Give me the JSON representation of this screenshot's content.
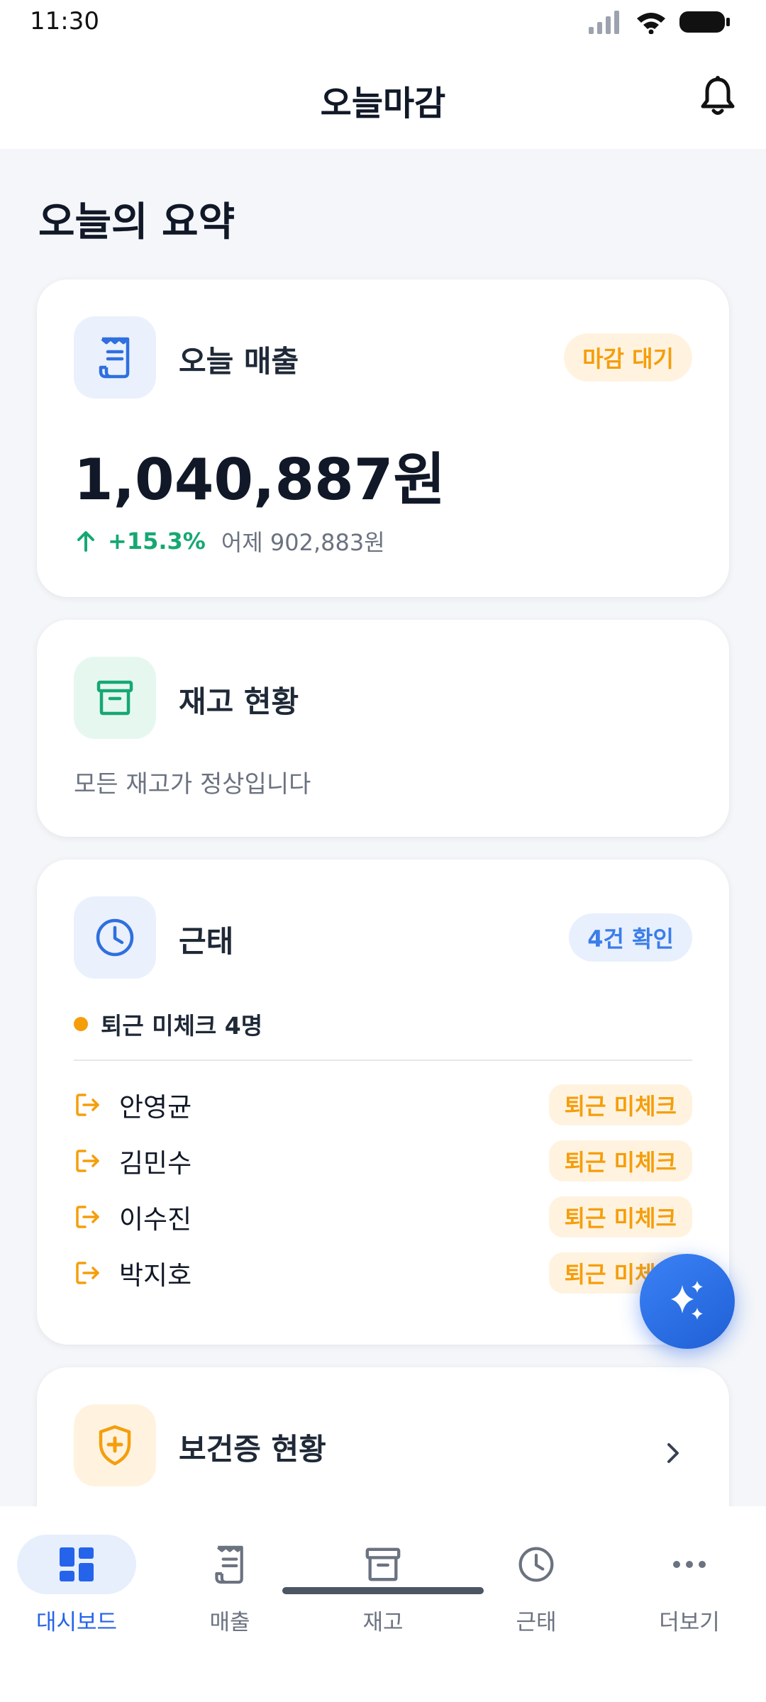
{
  "status_bar": {
    "time": "11:30"
  },
  "app_bar": {
    "title": "오늘마감"
  },
  "summary_title": "오늘의 요약",
  "sales_card": {
    "title": "오늘 매출",
    "badge": "마감 대기",
    "amount": "1,040,887원",
    "change_pct": "+15.3%",
    "yesterday": "어제 902,883원"
  },
  "inventory_card": {
    "title": "재고 현황",
    "message": "모든 재고가 정상입니다"
  },
  "attendance_card": {
    "title": "근태",
    "badge": "4건 확인",
    "summary": "퇴근 미체크 4명",
    "employees": [
      {
        "name": "안영균",
        "status": "퇴근 미체크"
      },
      {
        "name": "김민수",
        "status": "퇴근 미체크"
      },
      {
        "name": "이수진",
        "status": "퇴근 미체크"
      },
      {
        "name": "박지호",
        "status": "퇴근 미체크"
      }
    ]
  },
  "health_card": {
    "title": "보건증 현황"
  },
  "bottom_nav": {
    "items": [
      {
        "label": "대시보드",
        "icon": "dashboard-icon",
        "active": true
      },
      {
        "label": "매출",
        "icon": "receipt-icon",
        "active": false
      },
      {
        "label": "재고",
        "icon": "archive-icon",
        "active": false
      },
      {
        "label": "근태",
        "icon": "clock-icon",
        "active": false
      },
      {
        "label": "더보기",
        "icon": "more-icon",
        "active": false
      }
    ]
  },
  "colors": {
    "primary": "#2563eb",
    "success": "#16a873",
    "warning": "#f59e0b",
    "background": "#f4f6f9"
  }
}
